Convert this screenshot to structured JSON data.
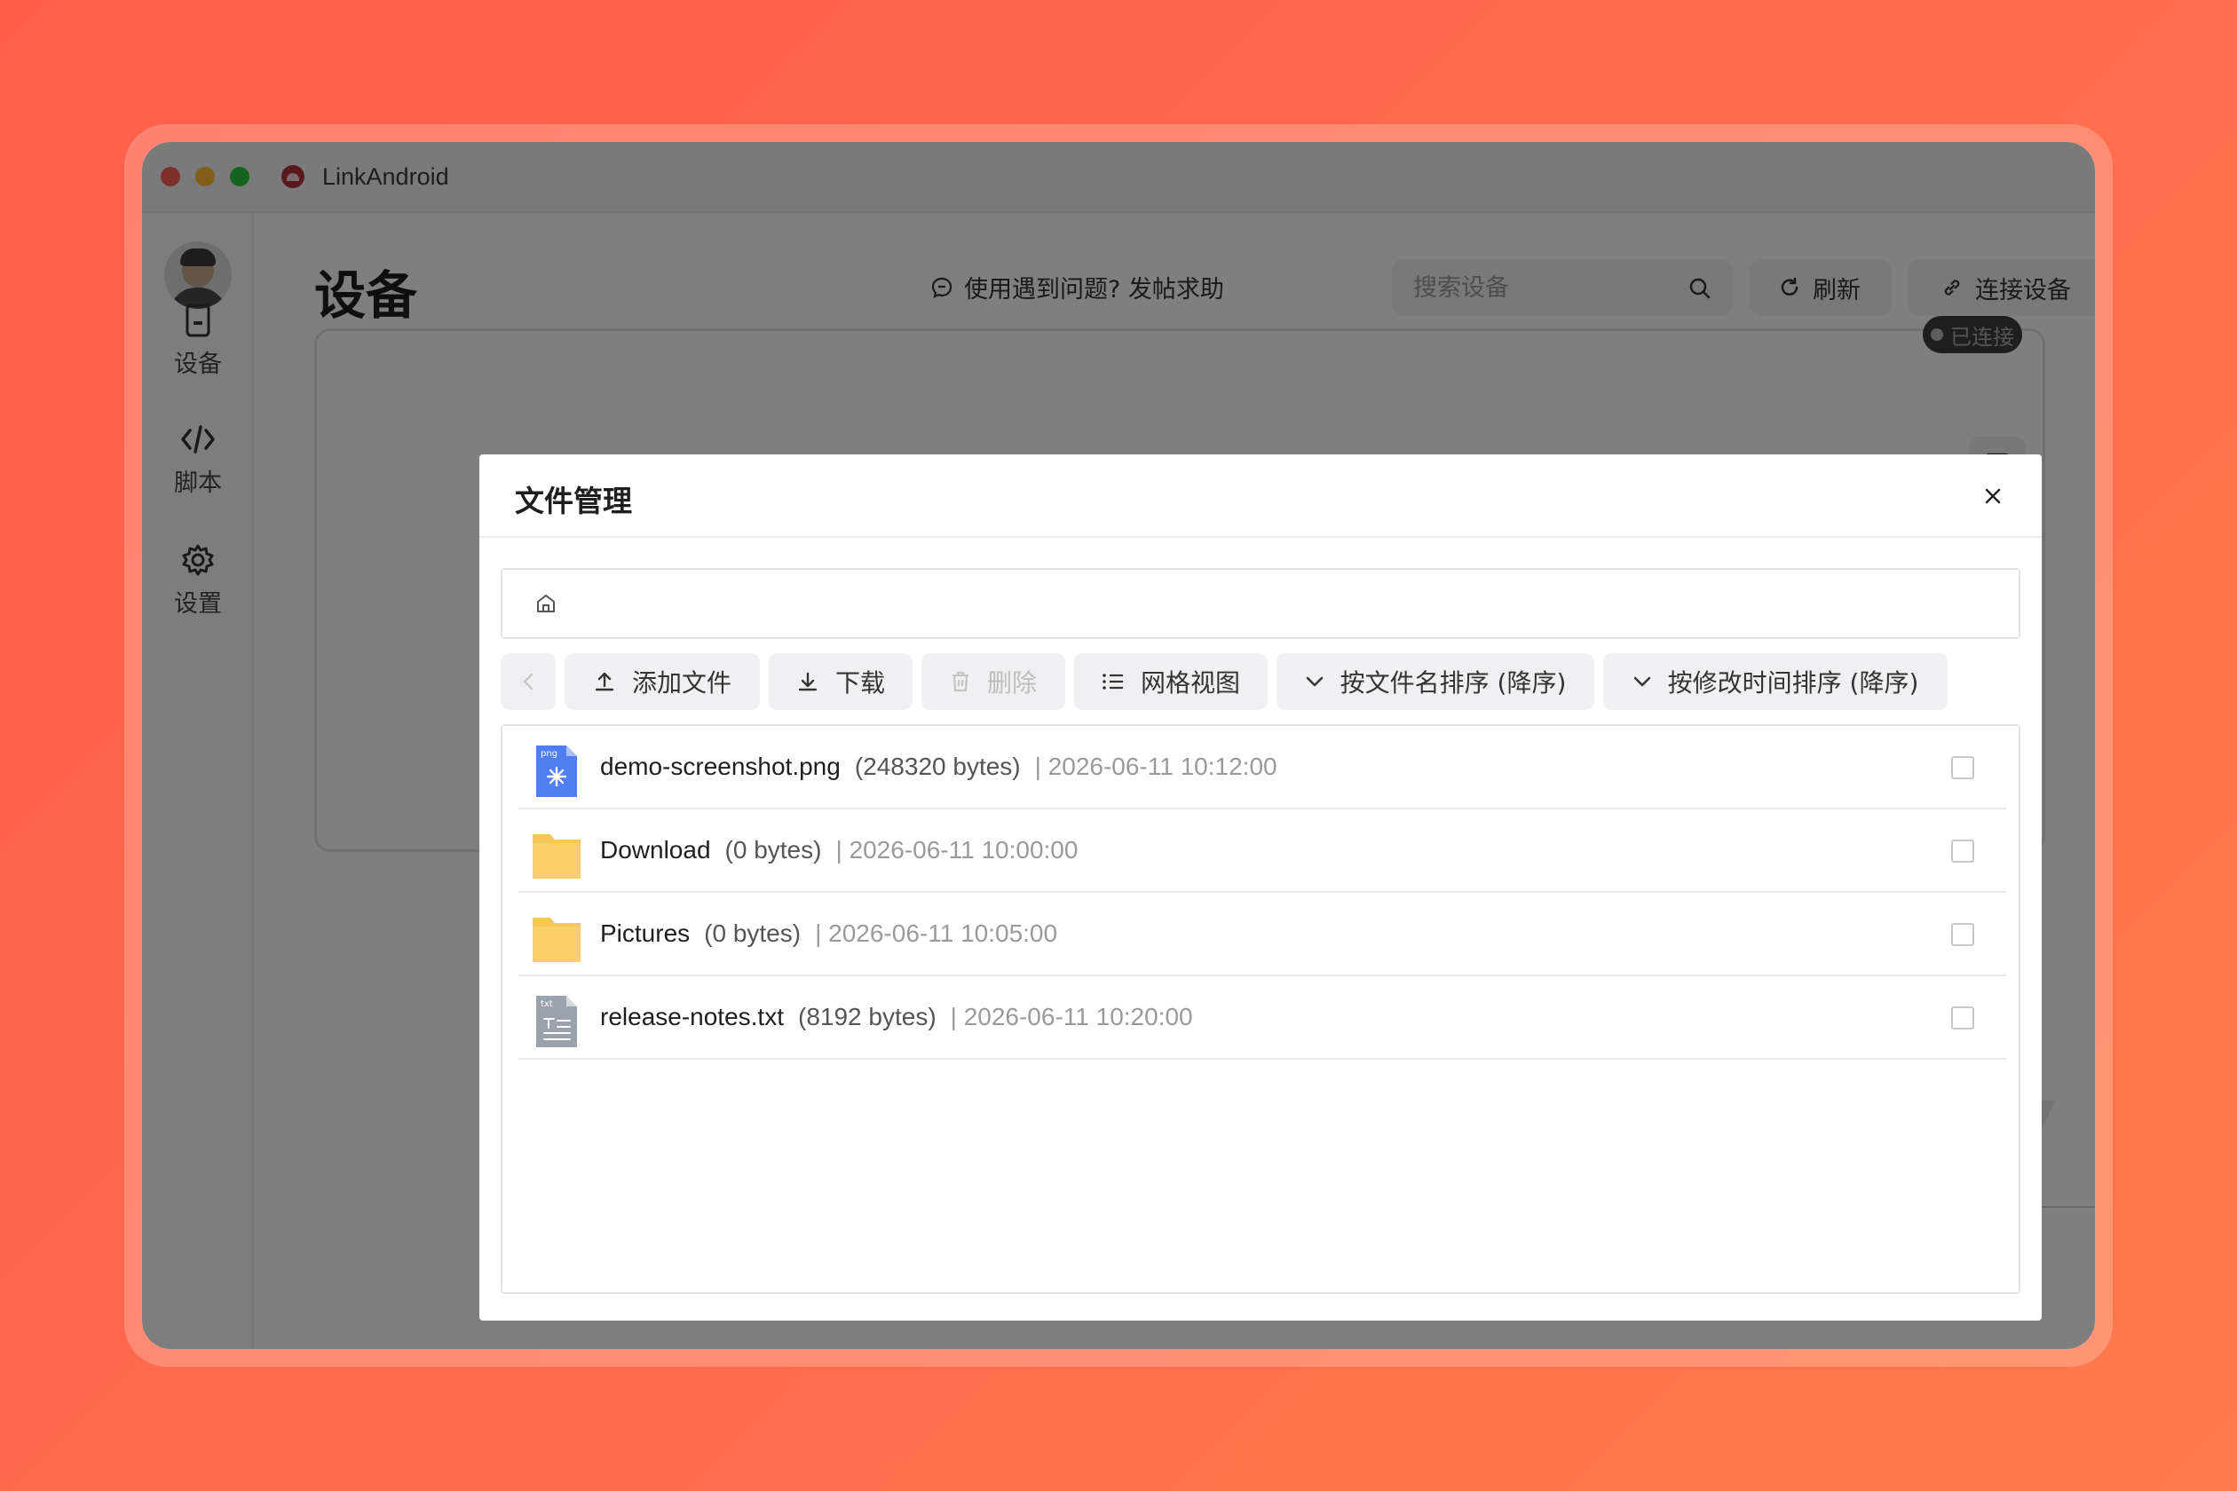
{
  "window": {
    "title": "LinkAndroid"
  },
  "sidebar": {
    "items": [
      {
        "label": "设备",
        "icon": "device-icon"
      },
      {
        "label": "脚本",
        "icon": "code-icon"
      },
      {
        "label": "设置",
        "icon": "gear-icon"
      }
    ]
  },
  "header": {
    "page_title": "设备",
    "help_text": "使用遇到问题? 发帖求助",
    "search_placeholder": "搜索设备",
    "refresh_label": "刷新",
    "connect_label": "连接设备"
  },
  "device_panel": {
    "status_badge": "已连接"
  },
  "modal": {
    "title": "文件管理",
    "toolbar": {
      "add_file": "添加文件",
      "download": "下载",
      "delete": "删除",
      "grid_view": "网格视图",
      "sort_by_name": "按文件名排序 (降序)",
      "sort_by_mtime": "按修改时间排序 (降序)"
    },
    "files": [
      {
        "name": "demo-screenshot.png",
        "size": "(248320 bytes)",
        "date": "| 2026-06-11 10:12:00",
        "type": "png",
        "icon_label": "png"
      },
      {
        "name": "Download",
        "size": "(0 bytes)",
        "date": "| 2026-06-11 10:00:00",
        "type": "folder"
      },
      {
        "name": "Pictures",
        "size": "(0 bytes)",
        "date": "| 2026-06-11 10:05:00",
        "type": "folder"
      },
      {
        "name": "release-notes.txt",
        "size": "(8192 bytes)",
        "date": "| 2026-06-11 10:20:00",
        "type": "txt",
        "icon_label": "txt"
      }
    ]
  },
  "colors": {
    "background": "#ff6b4d",
    "overlay": "rgba(0,0,0,0.5)",
    "folder": "#f7c75a",
    "png_file": "#4f7ef0",
    "txt_file": "#9aa2ad"
  }
}
